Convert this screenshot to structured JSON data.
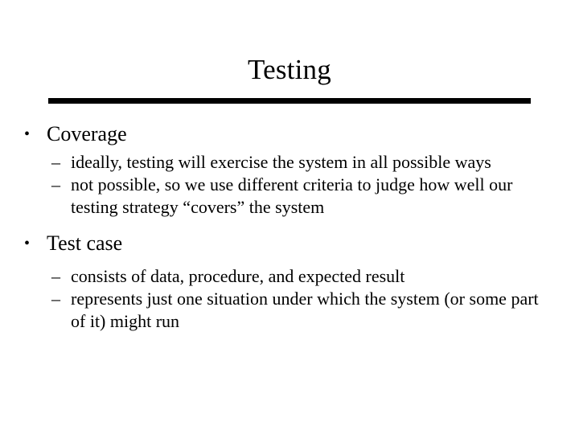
{
  "slide": {
    "title": "Testing",
    "background_color": "#ffffff",
    "text_color": "#000000",
    "rule_color": "#000000",
    "markers": {
      "level1": "•",
      "level2": "–"
    },
    "content": [
      {
        "label": "Coverage",
        "sub_items": [
          "ideally, testing will exercise the system in all possible ways",
          "not possible, so we use different criteria to judge how well our testing strategy “covers” the system"
        ]
      },
      {
        "label": "Test case",
        "sub_items": [
          "consists of data, procedure, and expected result",
          "represents just one situation under which the system (or some part of it) might run"
        ]
      }
    ]
  }
}
